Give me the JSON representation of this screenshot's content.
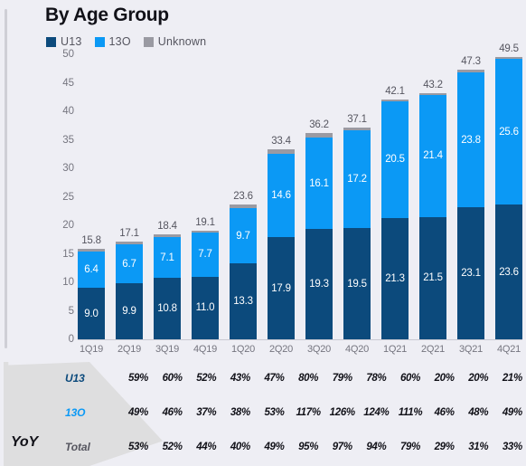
{
  "header": {
    "title": "By Age Group"
  },
  "legend": {
    "items": [
      {
        "label": "U13",
        "color": "#0c4a7c",
        "icon": "square-swatch-icon"
      },
      {
        "label": "13O",
        "color": "#0b99f5",
        "icon": "square-swatch-icon"
      },
      {
        "label": "Unknown",
        "color": "#9a9aa2",
        "icon": "square-swatch-icon"
      }
    ]
  },
  "yoy": {
    "banner_label": "YoY",
    "rows": [
      {
        "label": "U13",
        "color": "#0c4a7c",
        "values": [
          "59%",
          "60%",
          "52%",
          "43%",
          "47%",
          "80%",
          "79%",
          "78%",
          "60%",
          "20%",
          "20%",
          "21%"
        ]
      },
      {
        "label": "13O",
        "color": "#0b99f5",
        "values": [
          "49%",
          "46%",
          "37%",
          "38%",
          "53%",
          "117%",
          "126%",
          "124%",
          "111%",
          "46%",
          "48%",
          "49%"
        ]
      },
      {
        "label": "Total",
        "color": "#55555f",
        "values": [
          "53%",
          "52%",
          "44%",
          "40%",
          "49%",
          "95%",
          "97%",
          "94%",
          "79%",
          "29%",
          "31%",
          "33%"
        ]
      }
    ]
  },
  "chart_data": {
    "type": "bar",
    "stacked": true,
    "title": "By Age Group",
    "xlabel": "",
    "ylabel": "",
    "ylim": [
      0,
      50
    ],
    "yticks": [
      50,
      45,
      40,
      35,
      30,
      25,
      20,
      15,
      10,
      5,
      0
    ],
    "grid": false,
    "legend_position": "top-left",
    "categories": [
      "1Q19",
      "2Q19",
      "3Q19",
      "4Q19",
      "1Q20",
      "2Q20",
      "3Q20",
      "4Q20",
      "1Q21",
      "2Q21",
      "3Q21",
      "4Q21"
    ],
    "series": [
      {
        "name": "U13",
        "color": "#0c4a7c",
        "values": [
          9.0,
          9.9,
          10.8,
          11.0,
          13.3,
          17.9,
          19.3,
          19.5,
          21.3,
          21.5,
          23.1,
          23.6
        ],
        "labels": [
          "9.0",
          "9.9",
          "10.8",
          "11.0",
          "13.3",
          "17.9",
          "19.3",
          "19.5",
          "21.3",
          "21.5",
          "23.1",
          "23.6"
        ]
      },
      {
        "name": "13O",
        "color": "#0b99f5",
        "values": [
          6.4,
          6.7,
          7.1,
          7.7,
          9.7,
          14.6,
          16.1,
          17.2,
          20.5,
          21.4,
          23.8,
          25.6
        ],
        "labels": [
          "6.4",
          "6.7",
          "7.1",
          "7.7",
          "9.7",
          "14.6",
          "16.1",
          "17.2",
          "20.5",
          "21.4",
          "23.8",
          "25.6"
        ]
      },
      {
        "name": "Unknown",
        "color": "#9a9aa2",
        "values": [
          0.4,
          0.5,
          0.5,
          0.4,
          0.6,
          0.9,
          0.8,
          0.4,
          0.3,
          0.3,
          0.4,
          0.3
        ],
        "labels": [
          "",
          "",
          "",
          "",
          "",
          "",
          "",
          "",
          "",
          "",
          "",
          ""
        ]
      }
    ],
    "totals": [
      15.8,
      17.1,
      18.4,
      19.1,
      23.6,
      33.4,
      36.2,
      37.1,
      42.1,
      43.2,
      47.3,
      49.5
    ],
    "total_labels": [
      "15.8",
      "17.1",
      "18.4",
      "19.1",
      "23.6",
      "33.4",
      "36.2",
      "37.1",
      "42.1",
      "43.2",
      "47.3",
      "49.5"
    ]
  }
}
